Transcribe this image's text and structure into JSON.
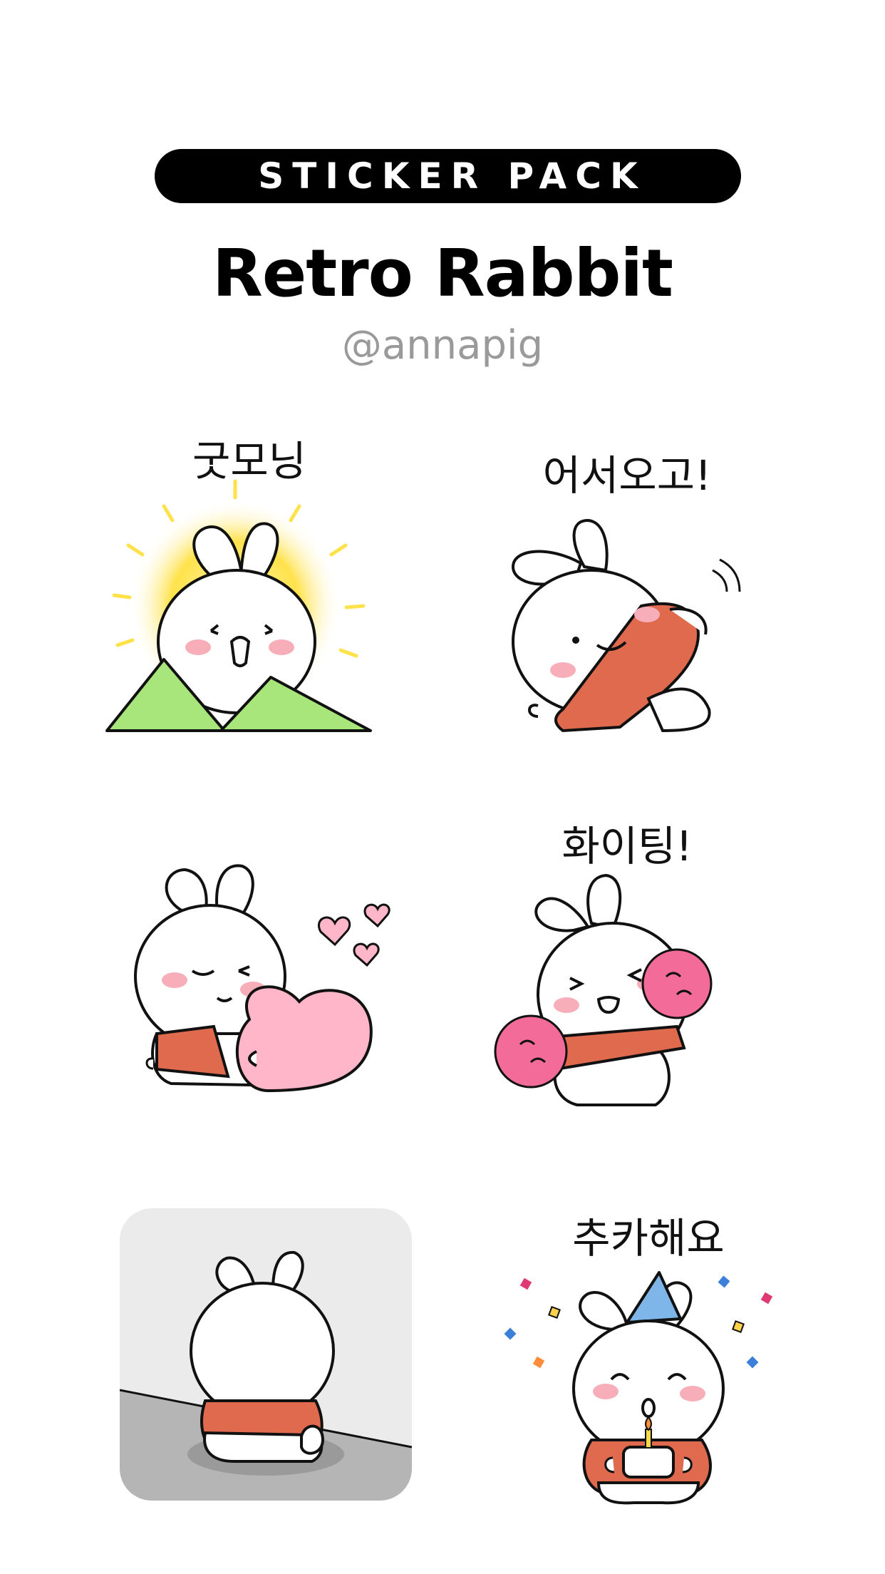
{
  "header": {
    "pack_label": "STICKER PACK",
    "title": "Retro Rabbit",
    "author": "@annapig"
  },
  "stickers": [
    {
      "caption": "굿모닝",
      "icon": "good-morning-rabbit-sunrise"
    },
    {
      "caption": "어서오고!",
      "icon": "waving-rabbit"
    },
    {
      "caption": "",
      "icon": "rabbit-hugging-heart"
    },
    {
      "caption": "화이팅!",
      "icon": "cheering-rabbit-pompoms"
    },
    {
      "caption": "",
      "icon": "sad-rabbit-in-corner"
    },
    {
      "caption": "추카해요",
      "icon": "birthday-rabbit-cake"
    }
  ],
  "colors": {
    "accent_orange": "#e06a4e",
    "blush": "#f7aeb8",
    "hill_green": "#a8e57a",
    "sun_yellow": "#ffe24a",
    "heart_pink": "#ffb6c8",
    "pompom_pink": "#f36b98",
    "party_hat": "#7fb6ea"
  }
}
